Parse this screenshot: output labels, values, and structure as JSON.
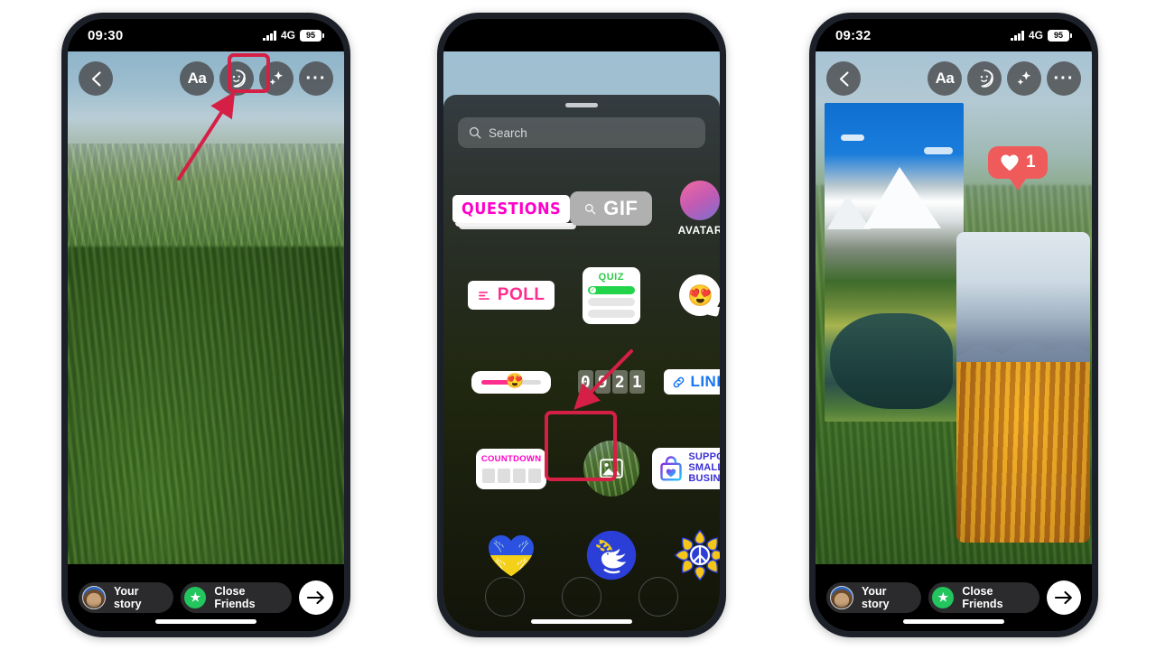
{
  "meta": {
    "accent_highlight": "#d61f45",
    "instagram_pink": "#ff00c8",
    "link_blue": "#1877f2",
    "heart_red": "#ef5b5b",
    "close_friends_green": "#22c55e"
  },
  "phones": [
    {
      "id": "phone-1",
      "status": {
        "time": "09:30",
        "network": "4G",
        "battery": "95"
      },
      "toolbar": {
        "back_label": "‹",
        "text_label": "Aa",
        "sticker_label": "sticker-smiley",
        "effects_label": "sparkles",
        "more_label": "···"
      },
      "bottom": {
        "your_story": "Your story",
        "close_friends": "Close Friends",
        "send": "→"
      }
    },
    {
      "id": "phone-2",
      "sheet": {
        "search_placeholder": "Search",
        "stickers": [
          {
            "key": "questions",
            "label": "QUESTIONS"
          },
          {
            "key": "gif",
            "label": "GIF"
          },
          {
            "key": "avatar",
            "label": "AVATAR"
          },
          {
            "key": "poll",
            "label": "POLL"
          },
          {
            "key": "quiz",
            "label": "QUIZ"
          },
          {
            "key": "emoji-reaction",
            "label": "😍"
          },
          {
            "key": "emoji-slider",
            "label": "😍"
          },
          {
            "key": "countdown-clock",
            "label": "0921"
          },
          {
            "key": "link",
            "label": "LINK"
          },
          {
            "key": "countdown",
            "label": "COUNTDOWN"
          },
          {
            "key": "photo",
            "label": ""
          },
          {
            "key": "support-small-business",
            "label": "SUPPORT SMALL BUSINESS"
          },
          {
            "key": "ukraine-heart",
            "label": ""
          },
          {
            "key": "peace-dove",
            "label": ""
          },
          {
            "key": "peace-sunflower",
            "label": ""
          }
        ],
        "counter_digits": [
          "0",
          "9",
          "2",
          "1"
        ],
        "ssb_lines": [
          "SUPPORT",
          "SMALL",
          "BUSINESS"
        ]
      }
    },
    {
      "id": "phone-3",
      "status": {
        "time": "09:32",
        "network": "4G",
        "battery": "95"
      },
      "toolbar": {
        "back_label": "‹",
        "text_label": "Aa",
        "sticker_label": "sticker-smiley",
        "effects_label": "sparkles",
        "more_label": "···"
      },
      "heart_badge": {
        "count": "1"
      },
      "bottom": {
        "your_story": "Your story",
        "close_friends": "Close Friends",
        "send": "→"
      }
    }
  ]
}
